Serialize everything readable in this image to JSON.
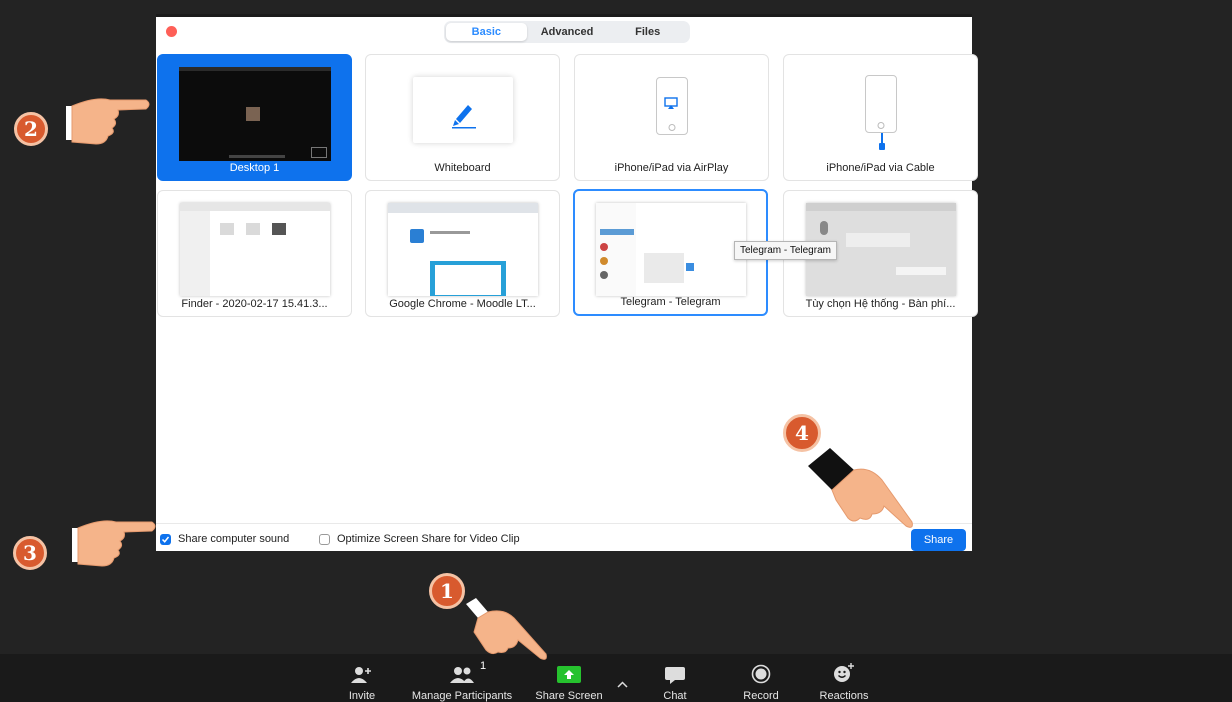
{
  "dialog": {
    "tabs": [
      "Basic",
      "Advanced",
      "Files"
    ],
    "active_tab": "Basic",
    "tiles": [
      {
        "caption": "Desktop 1",
        "kind": "desktop",
        "selected": true
      },
      {
        "caption": "Whiteboard",
        "kind": "whiteboard"
      },
      {
        "caption": "iPhone/iPad via AirPlay",
        "kind": "airplay"
      },
      {
        "caption": "iPhone/iPad via Cable",
        "kind": "cable"
      },
      {
        "caption": "Finder - 2020-02-17 15.41.3...",
        "kind": "window"
      },
      {
        "caption": "Google Chrome - Moodle LT...",
        "kind": "window"
      },
      {
        "caption": "Telegram - Telegram",
        "kind": "window",
        "focused": true
      },
      {
        "caption": "Tùy chọn Hệ thống - Bàn phí...",
        "kind": "window"
      }
    ],
    "tooltip": "Telegram - Telegram",
    "options": {
      "share_sound": {
        "label": "Share computer sound",
        "checked": true
      },
      "optimize_video": {
        "label": "Optimize Screen Share for Video Clip",
        "checked": false
      }
    },
    "share_button": "Share"
  },
  "toolbar": {
    "items": [
      {
        "label": "Invite",
        "icon": "invite-icon"
      },
      {
        "label": "Manage Participants",
        "icon": "participants-icon",
        "badge": "1"
      },
      {
        "label": "Share Screen",
        "icon": "share-screen-icon"
      },
      {
        "label": "Chat",
        "icon": "chat-icon"
      },
      {
        "label": "Record",
        "icon": "record-icon"
      },
      {
        "label": "Reactions",
        "icon": "reactions-icon"
      }
    ]
  },
  "annotations": {
    "step1": "1",
    "step2": "2",
    "step3": "3",
    "step4": "4"
  },
  "colors": {
    "accent": "#0e72ed",
    "share_green": "#26c22e",
    "annotation": "#d85a2e"
  }
}
